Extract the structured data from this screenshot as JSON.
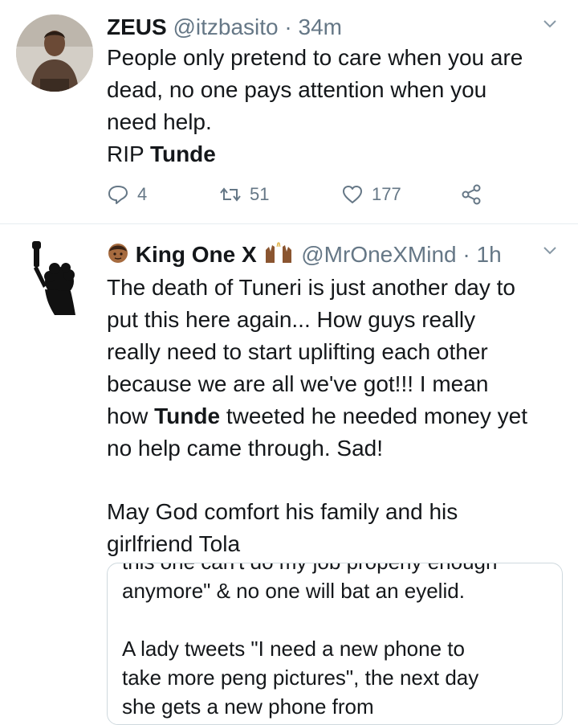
{
  "tweet1": {
    "name": "ZEUS",
    "handle": "@itzbasito",
    "separator": "·",
    "time": "34m",
    "lines": [
      "People only pretend to care when you are",
      "dead, no one pays attention when you",
      "need help."
    ],
    "last_line_prefix": "RIP ",
    "last_line_bold": "Tunde",
    "reply_count": "4",
    "retweet_count": "51",
    "like_count": "177"
  },
  "tweet2": {
    "name": "King One X",
    "handle": "@MrOneXMind",
    "separator": "·",
    "time": "1h",
    "lines": [
      "The death of Tuneri is just another day to",
      "put this here again... How guys really",
      "really need to start uplifting each other",
      "because we are all we've got!!! I mean"
    ],
    "line5_prefix": "how ",
    "line5_bold": "Tunde",
    "line5_suffix": " tweeted he needed money yet",
    "line6": "no help came through. Sad!",
    "para2_lines": [
      "May God comfort his family and his",
      "girlfriend Tola"
    ],
    "quote_lines": [
      "this one can't do my job properly enough",
      "anymore\" & no one will bat an eyelid.",
      "",
      "A lady tweets \"I need a new phone to",
      "take more peng pictures\", the next day",
      "she gets a new phone from"
    ]
  },
  "colors": {
    "text": "#14171a",
    "secondary": "#657786",
    "divider": "#e6ecf0"
  },
  "icons": {
    "reply": "reply-icon",
    "retweet": "retweet-icon",
    "like": "heart-icon",
    "share": "share-icon",
    "caret": "chevron-down-icon"
  }
}
